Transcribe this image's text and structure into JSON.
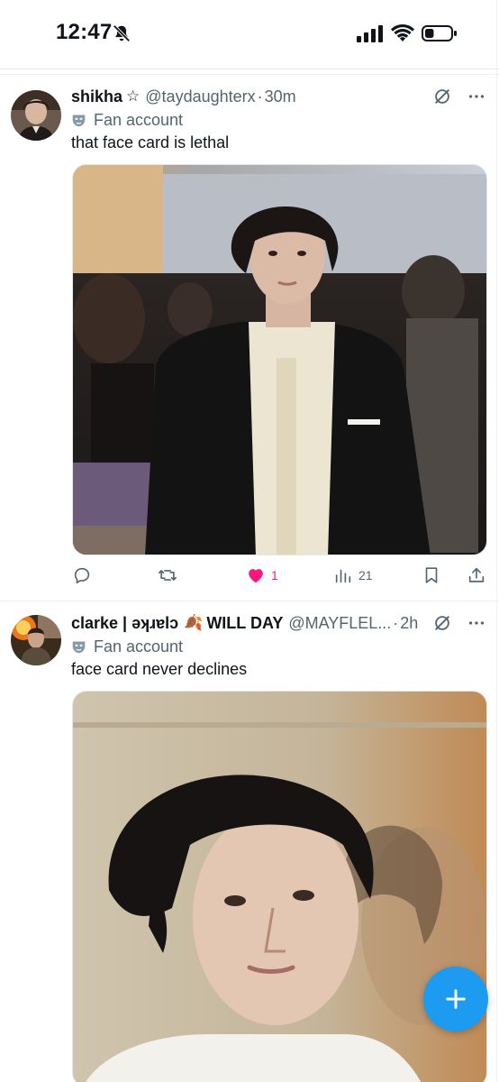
{
  "status_bar": {
    "time": "12:47",
    "icons": [
      "bell-slash-icon",
      "cellular-signal-icon",
      "wifi-icon",
      "battery-icon"
    ],
    "battery_level": 0.35
  },
  "colors": {
    "text": "#0f1419",
    "secondary_text": "#536471",
    "like_pink": "#f91880",
    "accent_blue": "#1d9bf0",
    "divider": "#eff3f4"
  },
  "tweets": [
    {
      "display_name": "shikha",
      "name_suffix_icon": "star-outline-icon",
      "name_suffix": "☆",
      "handle": "@taydaughterx",
      "separator": "·",
      "time": "30m",
      "label_icon": "mask-icon",
      "label": "Fan account",
      "text": "that face card is lethal",
      "media_icon": "photo",
      "actions": {
        "reply_count": "",
        "retweet_count": "",
        "like_count": "1",
        "liked": true,
        "views_count": "21"
      }
    },
    {
      "display_name": "clarke | ǝʞɹɐlɔ",
      "name_emoji": "🍂",
      "name_extra": "WILL DAY",
      "handle": "@MAYFLEL...",
      "separator": "·",
      "time": "2h",
      "label_icon": "mask-icon",
      "label": "Fan account",
      "text": "face card never declines",
      "media_icon": "photo"
    }
  ],
  "fab": {
    "icon": "plus-icon",
    "label": "+"
  }
}
